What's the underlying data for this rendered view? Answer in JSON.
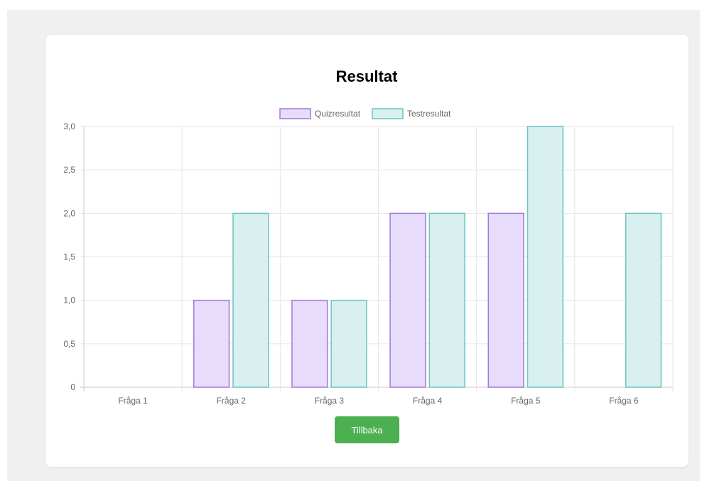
{
  "colors": {
    "quiz_fill": "#e7dcfc",
    "quiz_border": "#a17ad6",
    "test_fill": "#d8f0ef",
    "test_border": "#6cc4c4",
    "button_bg": "#4caf50"
  },
  "actions": {
    "back_label": "Tillbaka"
  },
  "chart_data": {
    "type": "bar",
    "title": "Resultat",
    "categories": [
      "Fråga 1",
      "Fråga 2",
      "Fråga 3",
      "Fråga 4",
      "Fråga 5",
      "Fråga 6"
    ],
    "series": [
      {
        "name": "Quizresultat",
        "values": [
          0,
          1,
          1,
          2,
          2,
          0
        ]
      },
      {
        "name": "Testresultat",
        "values": [
          0,
          2,
          1,
          2,
          3,
          2
        ]
      }
    ],
    "ylim": [
      0,
      3
    ],
    "yticks": [
      "0",
      "0,5",
      "1,0",
      "1,5",
      "2,0",
      "2,5",
      "3,0"
    ],
    "grid": true,
    "legend_position": "top"
  }
}
